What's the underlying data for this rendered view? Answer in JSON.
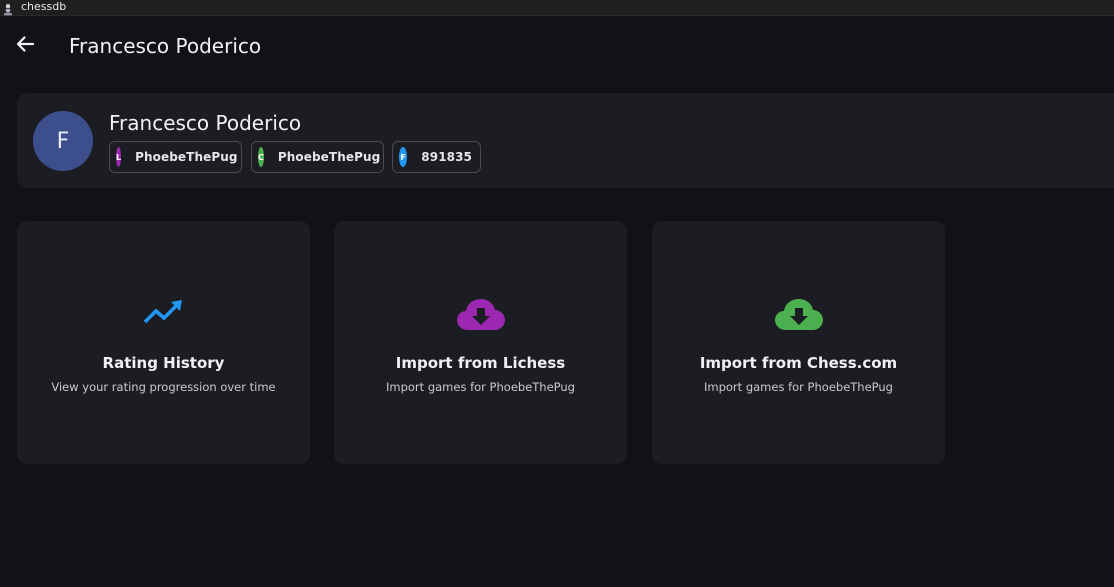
{
  "window": {
    "title": "chessdb",
    "icon": "chess-pawn-icon"
  },
  "header": {
    "back_icon": "arrow-left-icon",
    "title": "Francesco Poderico"
  },
  "profile": {
    "avatar_initial": "F",
    "name": "Francesco Poderico",
    "accounts": [
      {
        "badge": "L",
        "label": "PhoebeThePug",
        "color": "#9c27b0"
      },
      {
        "badge": "C",
        "label": "PhoebeThePug",
        "color": "#4caf50"
      },
      {
        "badge": "F",
        "label": "891835",
        "color": "#2196f3"
      }
    ]
  },
  "actions": [
    {
      "title": "Rating History",
      "subtitle": "View your rating progression over time",
      "icon": "trending-up-icon",
      "color": "#2196f3"
    },
    {
      "title": "Import from Lichess",
      "subtitle": "Import games for PhoebeThePug",
      "icon": "cloud-download-icon",
      "color": "#9c27b0"
    },
    {
      "title": "Import from Chess.com",
      "subtitle": "Import games for PhoebeThePug",
      "icon": "cloud-download-icon",
      "color": "#4caf50"
    }
  ],
  "colors": {
    "background": "#111218",
    "card": "#1c1c23",
    "avatar": "#3d4e8c"
  }
}
